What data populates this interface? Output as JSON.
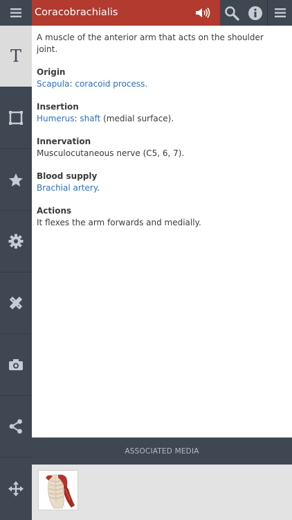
{
  "header": {
    "title": "Coracobrachialis",
    "title_bg": "#b23a2e",
    "bar_bg": "#3f4752",
    "icons": [
      "menu-icon",
      "speaker-icon",
      "search-icon",
      "info-icon",
      "menu-icon"
    ]
  },
  "sidebar": {
    "items": [
      {
        "icon": "text-icon",
        "glyph": "T",
        "active": true
      },
      {
        "icon": "frame-icon"
      },
      {
        "icon": "star-icon"
      },
      {
        "icon": "gear-icon"
      },
      {
        "icon": "ruler-pencil-icon"
      },
      {
        "icon": "camera-icon"
      },
      {
        "icon": "share-icon"
      },
      {
        "icon": "move-arrows-icon"
      }
    ]
  },
  "content": {
    "description": "A muscle of the anterior arm that acts on the shoulder joint.",
    "origin": {
      "title": "Origin",
      "link1": "Scapula",
      "sep": ": ",
      "link2": "coracoid process",
      "end": "."
    },
    "insertion": {
      "title": "Insertion",
      "link1": "Humerus",
      "sep": ": ",
      "link2": "shaft",
      "rest": " (medial surface)."
    },
    "innervation": {
      "title": "Innervation",
      "text": "Musculocutaneous nerve (C5, 6, 7)."
    },
    "blood_supply": {
      "title": "Blood supply",
      "link": "Brachial artery",
      "end": "."
    },
    "actions": {
      "title": "Actions",
      "text": "It flexes the arm forwards and medially."
    },
    "link_color": "#2f6fc2"
  },
  "media": {
    "label": "ASSOCIATED MEDIA",
    "thumbnail": "torso-muscle-thumbnail"
  }
}
